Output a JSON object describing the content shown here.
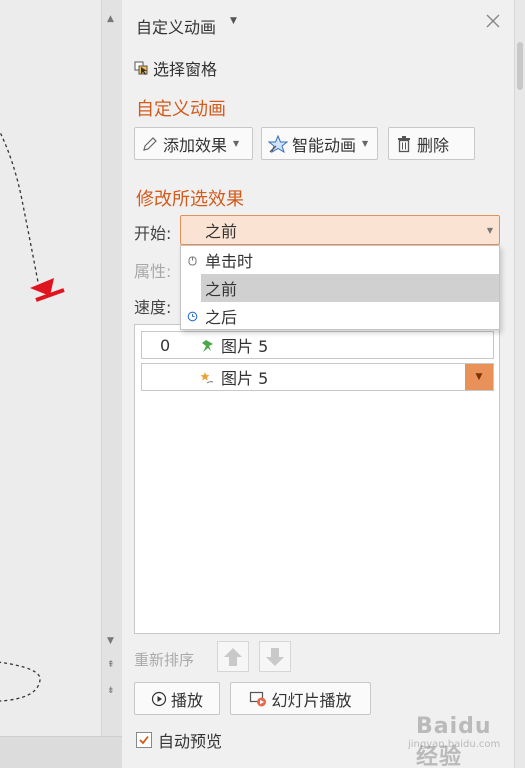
{
  "panel": {
    "title": "自定义动画",
    "select_pane_label": "选择窗格",
    "custom_section_title": "自定义动画",
    "modify_section_title": "修改所选效果"
  },
  "toolbar": {
    "add_effect_label": "添加效果",
    "smart_animation_label": "智能动画",
    "delete_label": "删除"
  },
  "fields": {
    "start_label": "开始:",
    "property_label": "属性:",
    "speed_label": "速度:",
    "start_value": "之前"
  },
  "start_dropdown": {
    "options": [
      {
        "label": "单击时",
        "icon": "mouse-click-icon"
      },
      {
        "label": "之前",
        "icon": "",
        "selected": true
      },
      {
        "label": "之后",
        "icon": "clock-icon"
      }
    ]
  },
  "animation_list": {
    "items": [
      {
        "order": "0",
        "name": "图片 5",
        "icon": "green-pin-effect-icon"
      },
      {
        "order": "",
        "name": "图片 5",
        "icon": "orange-star-effect-icon",
        "has_dropdown": true
      }
    ]
  },
  "reorder": {
    "label": "重新排序"
  },
  "playback": {
    "play_label": "播放",
    "slideshow_label": "幻灯片播放"
  },
  "auto_preview": {
    "label": "自动预览",
    "checked": true
  },
  "watermark": {
    "text": "Baidu经验",
    "url_text": "jingyan.baidu.com"
  },
  "colors": {
    "accent": "#d35b1c",
    "selection_fill": "#fbe3d3",
    "dropdown_button": "#e8925a",
    "arrow_red": "#e0141e"
  }
}
